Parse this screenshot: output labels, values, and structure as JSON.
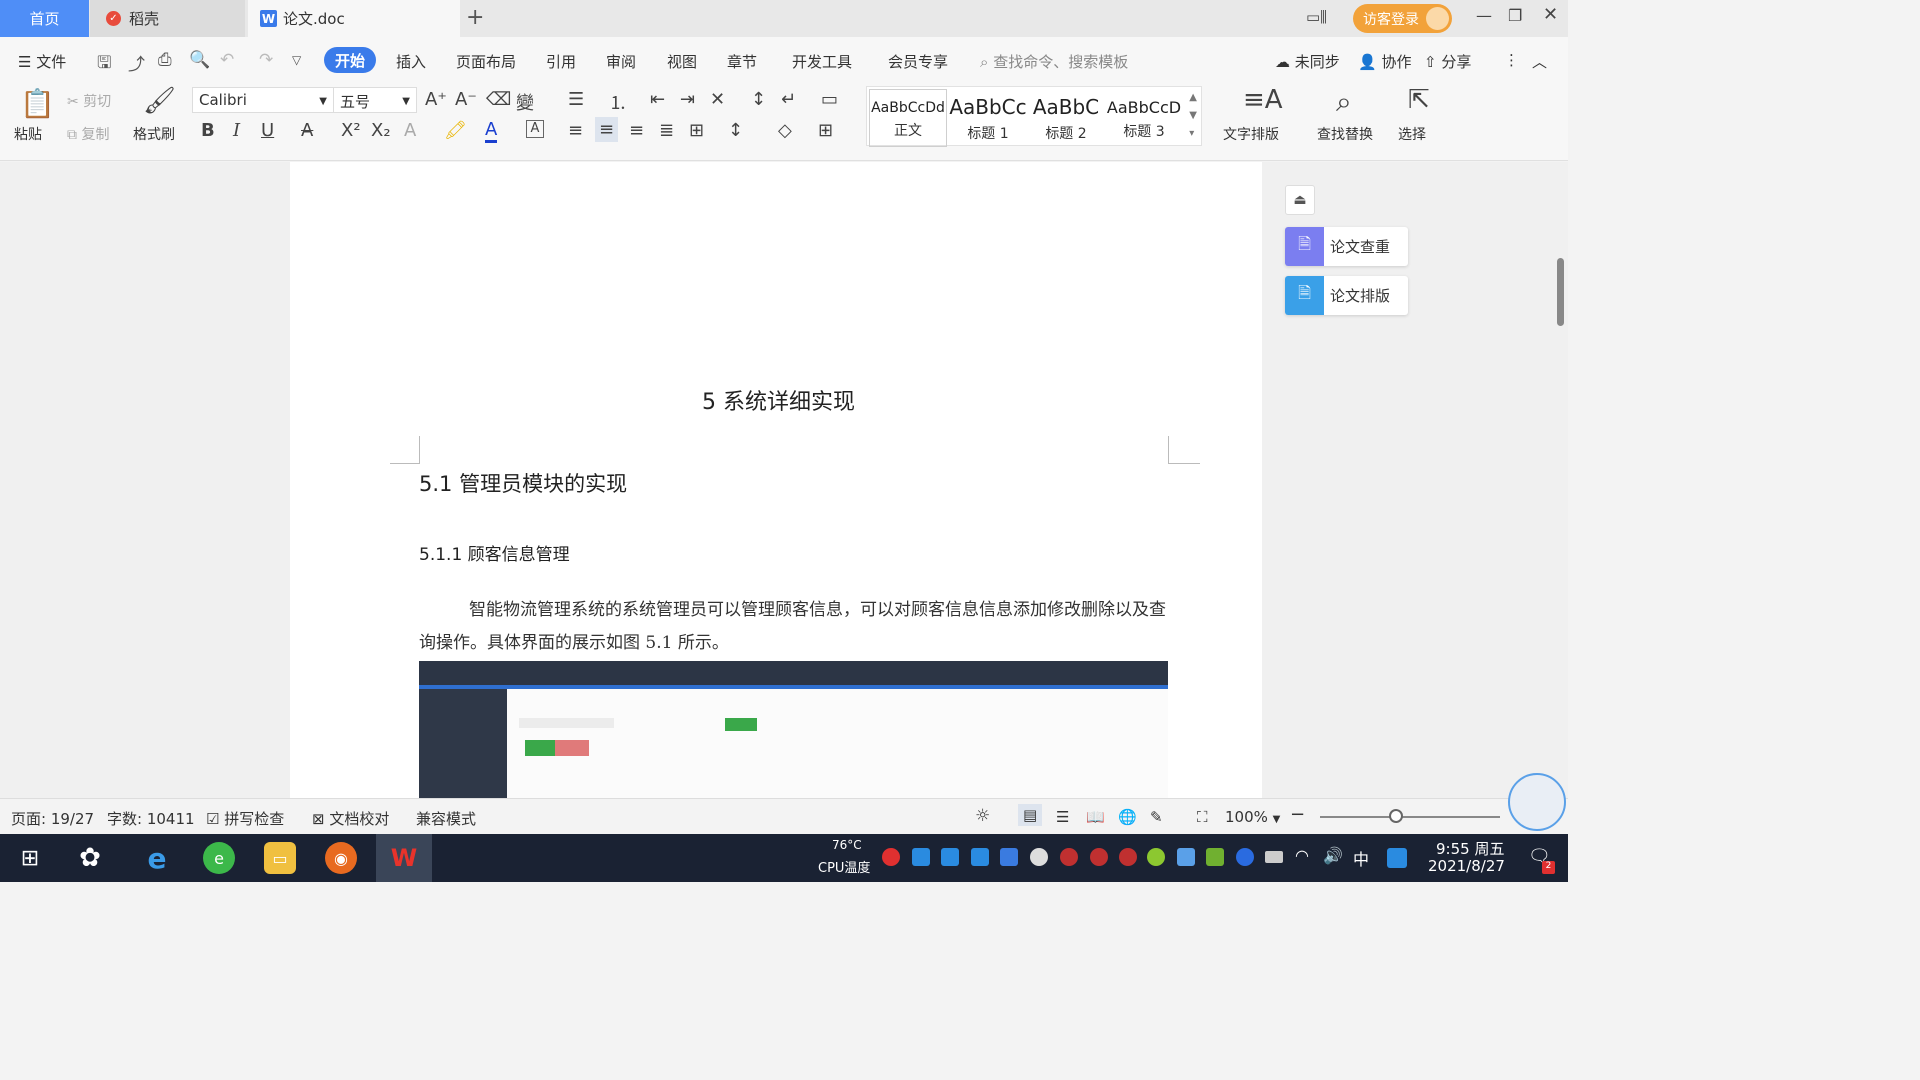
{
  "tabs": {
    "home": "首页",
    "daoke": "稻壳",
    "doc": "论文.doc",
    "new": "+"
  },
  "titlebar": {
    "guest_login": "访客登录"
  },
  "menu": {
    "file": "文件",
    "items": [
      "开始",
      "插入",
      "页面布局",
      "引用",
      "审阅",
      "视图",
      "章节",
      "开发工具",
      "会员专享"
    ],
    "search_placeholder": "查找命令、搜索模板",
    "unsynced": "未同步",
    "collab": "协作",
    "share": "分享"
  },
  "ribbon": {
    "paste": "粘贴",
    "cut": "剪切",
    "copy": "复制",
    "format_painter": "格式刷",
    "font_name": "Calibri",
    "font_size": "五号",
    "styles": [
      {
        "sample": "AaBbCcDd",
        "name": "正文"
      },
      {
        "sample": "AaBbCc",
        "name": "标题 1"
      },
      {
        "sample": "AaBbC",
        "name": "标题 2"
      },
      {
        "sample": "AaBbCcD",
        "name": "标题 3"
      }
    ],
    "text_layout": "文字排版",
    "find_replace": "查找替换",
    "select": "选择"
  },
  "document": {
    "chapter_title": "5 系统详细实现",
    "heading2": "5.1  管理员模块的实现",
    "heading3": "5.1.1  顾客信息管理",
    "paragraph": "智能物流管理系统的系统管理员可以管理顾客信息，可以对顾客信息信息添加修改删除以及查询操作。具体界面的展示如图 5.1 所示。"
  },
  "side_panel": {
    "check": "论文查重",
    "layout": "论文排版"
  },
  "status": {
    "page": "页面: 19/27",
    "words": "字数: 10411",
    "spell": "拼写检查",
    "proof": "文档校对",
    "compat": "兼容模式",
    "zoom": "100%",
    "zoom_level": 0.42
  },
  "taskbar": {
    "temp": "76°C",
    "cpu_label": "CPU温度",
    "ime": "中",
    "time": "9:55 周五",
    "date": "2021/8/27",
    "notif_count": "2"
  },
  "colors": {
    "accent": "#3a7bea",
    "home_tab": "#4f8ef7",
    "login": "#f2a23a",
    "check_icon": "#7b7ef0",
    "layout_icon": "#3aa0e8"
  }
}
